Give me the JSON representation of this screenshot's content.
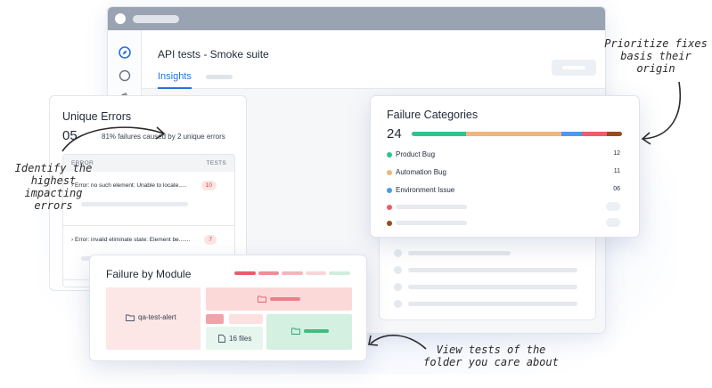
{
  "window": {
    "page_title": "API tests - Smoke suite",
    "active_tab": "Insights",
    "sidebar_icons": [
      "compass-icon",
      "circle-icon",
      "history-icon",
      "trend-icon",
      "gear-icon"
    ]
  },
  "unique_errors": {
    "title": "Unique Errors",
    "count": "05",
    "summary": "81% failures caused by 2 unique errors",
    "columns": [
      "ERROR",
      "TESTS"
    ],
    "rows": [
      {
        "error": "Error: no such element: Unable to locate.....",
        "tests": "10"
      },
      {
        "error": "Error: invalid eliminate state: Element be.......",
        "tests": "7"
      }
    ]
  },
  "failure_categories": {
    "title": "Failure Categories",
    "total": "24",
    "items": [
      {
        "label": "Product Bug",
        "value": "12",
        "color": "#2fc48d"
      },
      {
        "label": "Automation Bug",
        "value": "11",
        "color": "#f2b57a"
      },
      {
        "label": "Environment Issue",
        "value": "06",
        "color": "#4a9af0"
      }
    ],
    "placeholder_colors": [
      "#ef5b6a",
      "#9b4a1e"
    ],
    "bar_segments": [
      {
        "color": "#2fc48d",
        "share": 0.26
      },
      {
        "color": "#f2b57a",
        "share": 0.45
      },
      {
        "color": "#4a9af0",
        "share": 0.1
      },
      {
        "color": "#ef5b6a",
        "share": 0.12
      },
      {
        "color": "#9b4a1e",
        "share": 0.07
      }
    ]
  },
  "failure_by_module": {
    "title": "Failure by Module",
    "folder_label": "qa-test-alert",
    "files_label": "16 files",
    "legend_colors": [
      "#ea5b6c",
      "#f08c96",
      "#f5b5bb",
      "#f8d6d8",
      "#cfeedd"
    ]
  },
  "annotations": {
    "left": "Identify the\nhighest\nimpacting\nerrors",
    "top_right": "Prioritize fixes\nbasis their\norigin",
    "bottom": "View tests of the\nfolder you care about"
  },
  "colors": {
    "accent": "#2b6fe0",
    "badge_text": "#d23b3b",
    "badge_bg": "#fde4e4"
  }
}
